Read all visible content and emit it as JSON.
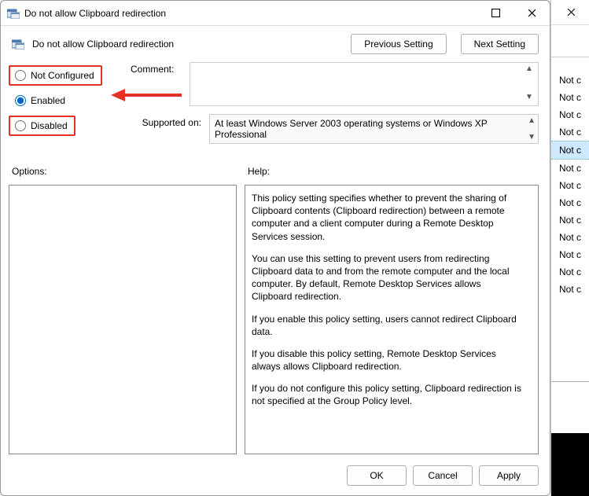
{
  "window": {
    "title": "Do not allow Clipboard redirection"
  },
  "header": {
    "title": "Do not allow Clipboard redirection",
    "prev": "Previous Setting",
    "next": "Next Setting"
  },
  "radios": {
    "not_configured": "Not Configured",
    "enabled": "Enabled",
    "disabled": "Disabled"
  },
  "comment": {
    "label": "Comment:",
    "value": ""
  },
  "supported": {
    "label": "Supported on:",
    "value": "At least Windows Server 2003 operating systems or Windows XP Professional"
  },
  "sections": {
    "options": "Options:",
    "help": "Help:"
  },
  "help": {
    "p1": "This policy setting specifies whether to prevent the sharing of Clipboard contents (Clipboard redirection) between a remote computer and a client computer during a Remote Desktop Services session.",
    "p2": "You can use this setting to prevent users from redirecting Clipboard data to and from the remote computer and the local computer. By default, Remote Desktop Services allows Clipboard redirection.",
    "p3": "If you enable this policy setting, users cannot redirect Clipboard data.",
    "p4": "If you disable this policy setting, Remote Desktop Services always allows Clipboard redirection.",
    "p5": "If you do not configure this policy setting, Clipboard redirection is not specified at the Group Policy level."
  },
  "buttons": {
    "ok": "OK",
    "cancel": "Cancel",
    "apply": "Apply"
  },
  "bg_items": [
    "Not c",
    "Not c",
    "Not c",
    "Not c",
    "Not c",
    "Not c",
    "Not c",
    "Not c",
    "Not c",
    "Not c",
    "Not c",
    "Not c",
    "Not c"
  ]
}
